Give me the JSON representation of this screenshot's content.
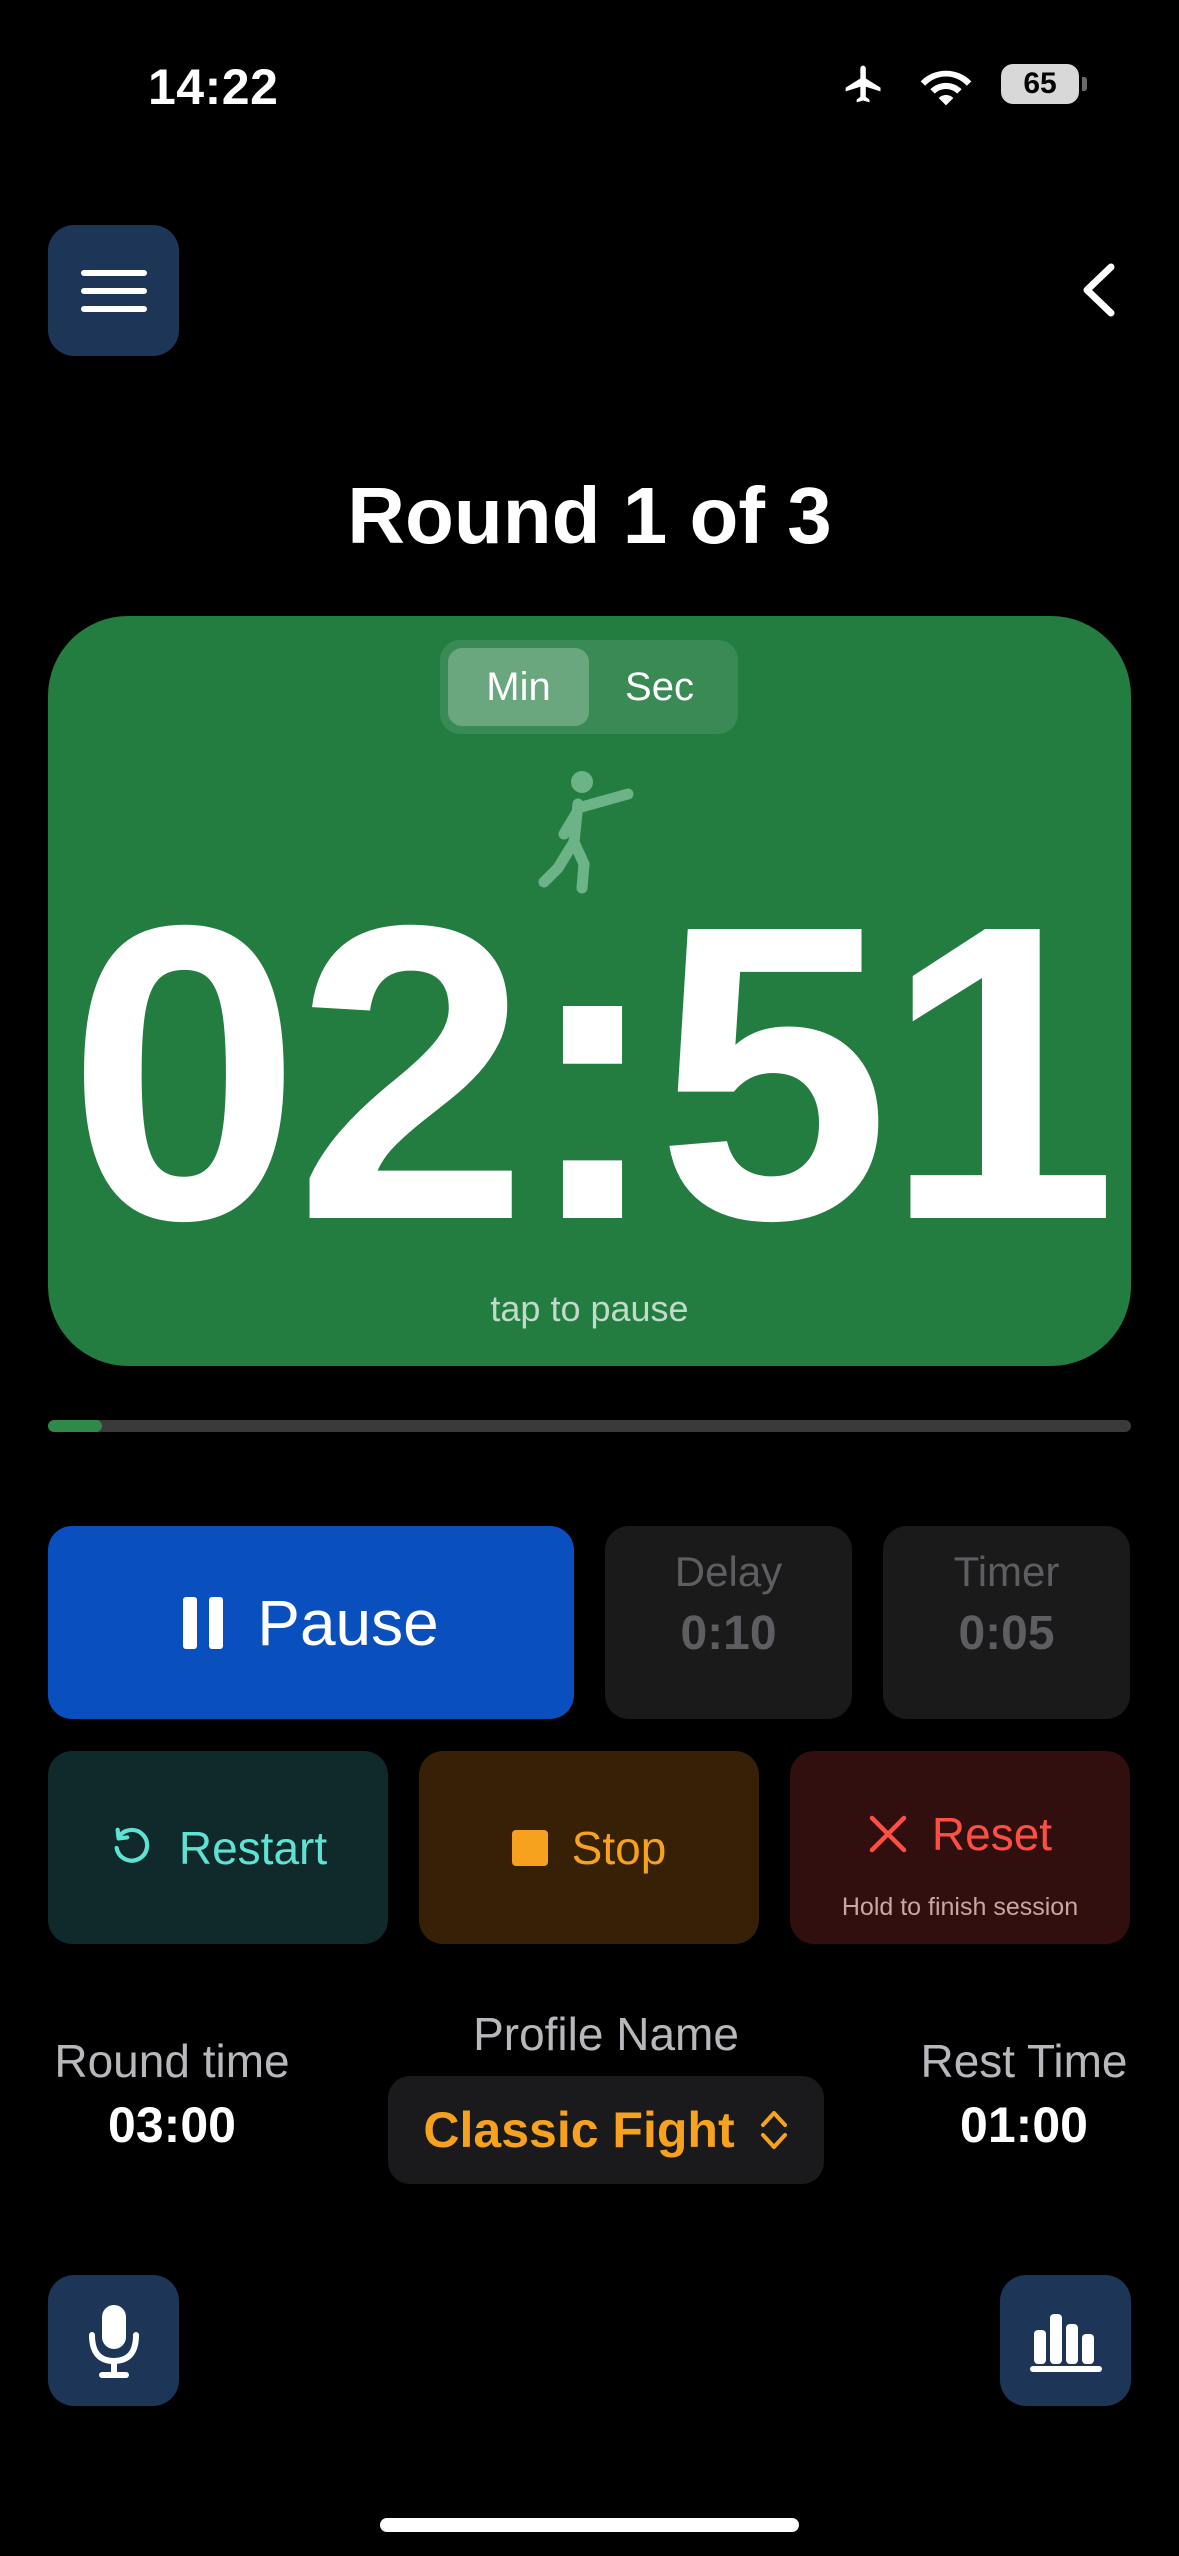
{
  "status_bar": {
    "time": "14:22",
    "battery": "65"
  },
  "header": {
    "round_title": "Round 1 of 3"
  },
  "timer": {
    "unit_toggle": {
      "options": [
        "Min",
        "Sec"
      ],
      "selected": "Min"
    },
    "time": "02:51",
    "hint": "tap to pause",
    "progress_fraction": 0.05,
    "card_color": "#237d41"
  },
  "controls": {
    "pause_label": "Pause",
    "delay": {
      "label": "Delay",
      "value": "0:10"
    },
    "timer": {
      "label": "Timer",
      "value": "0:05"
    },
    "restart_label": "Restart",
    "stop_label": "Stop",
    "reset_label": "Reset",
    "reset_hint": "Hold to finish session"
  },
  "info": {
    "round_time": {
      "label": "Round time",
      "value": "03:00"
    },
    "profile": {
      "label": "Profile Name",
      "value": "Classic Fight"
    },
    "rest_time": {
      "label": "Rest Time",
      "value": "01:00"
    }
  },
  "icons": [
    "menu-icon",
    "back-chevron-icon",
    "fighter-icon",
    "pause-icon",
    "restart-icon",
    "stop-icon",
    "close-icon",
    "updown-chevron-icon",
    "microphone-icon",
    "stats-icon",
    "airplane-icon",
    "wifi-icon",
    "battery-icon"
  ],
  "colors": {
    "accent_blue": "#0a4fbe",
    "orange": "#f7a21f",
    "teal": "#5fe2d4",
    "red": "#ff4f45"
  }
}
